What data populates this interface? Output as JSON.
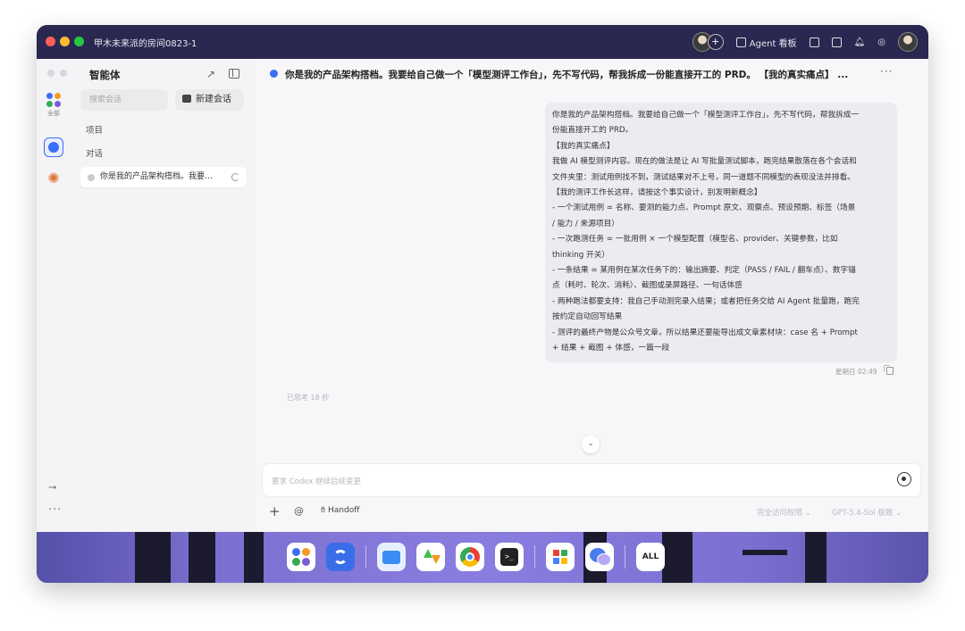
{
  "window": {
    "room_title": "甲木未来派的房间0823-1"
  },
  "titlebar": {
    "agent_board": "Agent 看板"
  },
  "sidebar": {
    "title": "智能体",
    "search_placeholder": "搜索会话",
    "new_chat": "新建会话",
    "section_projects": "项目",
    "section_conversations": "对话",
    "rail_all_label": "全部",
    "conversations": [
      {
        "title": "你是我的产品架构搭档。我要…"
      }
    ]
  },
  "chat": {
    "title": "你是我的产品架构搭档。我要给自己做一个「模型测评工作台」，先不写代码，帮我拆成一份能直接开工的 PRD。 【我的真实痛点】 ...",
    "message_lines": [
      "你是我的产品架构搭档。我要给自己做一个「模型测评工作台」，先不写代码，帮我拆成一",
      "份能直接开工的 PRD。",
      "【我的真实痛点】",
      "我做 AI 模型测评内容。现在的做法是让 AI 写批量测试脚本，跑完结果散落在各个会话和",
      "文件夹里：测试用例找不到，测试结果对不上号，同一道题不同模型的表现没法并排看。",
      "【我的测评工作长这样，请按这个事实设计，别发明新概念】",
      "- 一个测试用例 = 名称、要测的能力点、Prompt 原文、观察点、预设预期、标签（场景",
      "/ 能力 / 来源项目）",
      "- 一次跑测任务 = 一批用例 × 一个模型配置（模型名、provider、关键参数，比如",
      "thinking 开关）",
      "- 一条结果 = 某用例在某次任务下的：输出摘要、判定（PASS / FAIL / 翻车点）、数字锚",
      "点（耗时、轮次、消耗）、截图或录屏路径、一句话体感",
      "- 两种跑法都要支持：我自己手动测完录入结果；或者把任务交给 AI Agent 批量跑，跑完",
      "按约定自动回写结果",
      "- 测评的最终产物是公众号文章，所以结果还要能导出成文章素材块：case 名 + Prompt",
      "+ 结果 + 截图 + 体感，一篇一段"
    ],
    "message_time": "星期日 02:49",
    "thinking_status": "已思考 18 秒",
    "input_placeholder": "要求 Codex 继续后续变更",
    "handoff": "Handoff",
    "permission": "完全访问权限",
    "model": "GPT-5.4-Sol  极致"
  },
  "dock": {
    "all_label": "ALL"
  },
  "colors": {
    "accent": "#3b6ef5",
    "titlebar": "#2a2850",
    "dock_gradient": "#7b70d0"
  }
}
